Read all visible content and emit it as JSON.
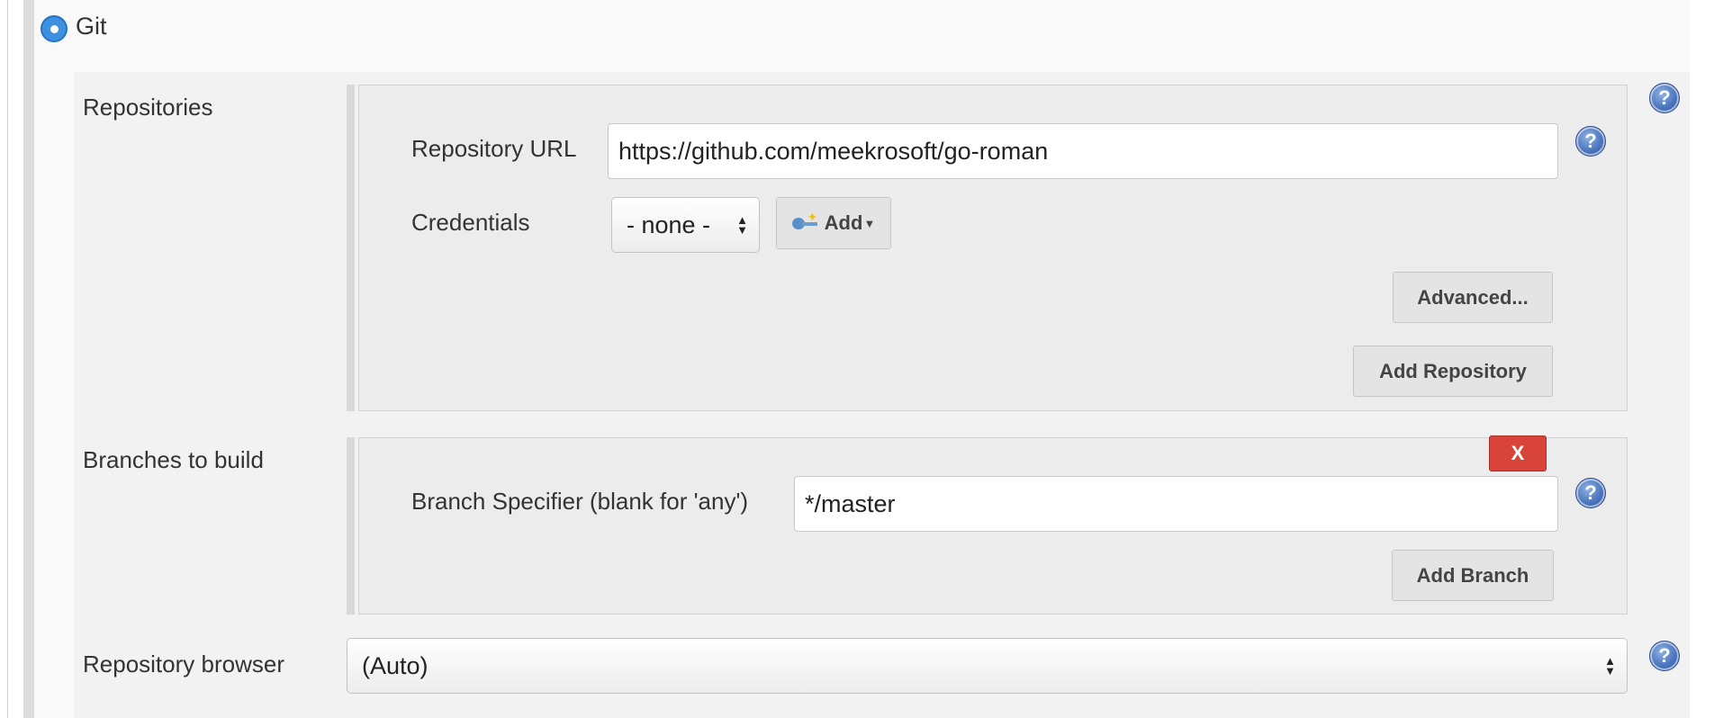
{
  "scm": {
    "option_label": "Git"
  },
  "repositories": {
    "label": "Repositories",
    "url_label": "Repository URL",
    "url_value": "https://github.com/meekrosoft/go-roman",
    "credentials_label": "Credentials",
    "credentials_selected": "- none -",
    "add_credentials_label": "Add",
    "advanced_label": "Advanced...",
    "add_repository_label": "Add Repository"
  },
  "branches": {
    "label": "Branches to build",
    "delete_label": "X",
    "specifier_label": "Branch Specifier (blank for 'any')",
    "specifier_value": "*/master",
    "add_branch_label": "Add Branch"
  },
  "browser": {
    "label": "Repository browser",
    "selected": "(Auto)"
  },
  "help_icon_text": "?",
  "colors": {
    "radio": "#3d8fe0",
    "delete": "#d9443a",
    "help": "#4b75bd"
  },
  "icons": [
    "help-icon",
    "key-icon",
    "radio-selected-icon"
  ]
}
